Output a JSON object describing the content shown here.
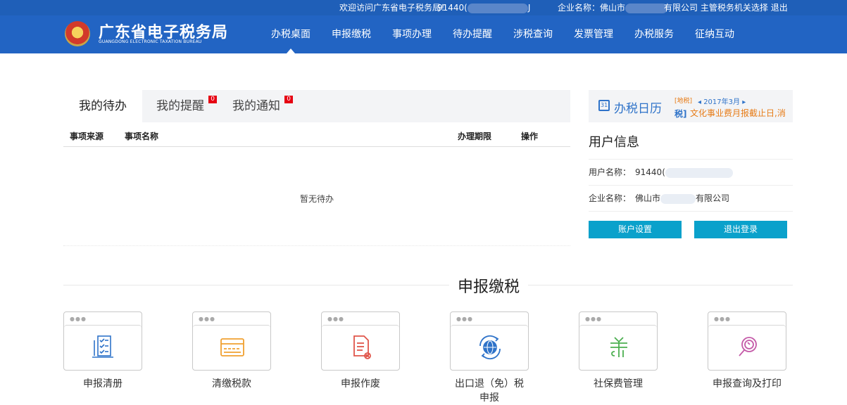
{
  "topbar": {
    "welcome": "欢迎访问广东省电子税务局！",
    "user_id_prefix": "91440(",
    "id_suffix": "J",
    "company_label": "企业名称：",
    "company_prefix": "佛山市",
    "company_suffix": "有限公司",
    "switch_authority": "主管税务机关选择",
    "logout": "退出"
  },
  "header": {
    "title": "广东省电子税务局",
    "subtitle": "GUANGDONG ELECTRONIC TAXATION BUREAU",
    "nav": [
      "办税桌面",
      "申报缴税",
      "事项办理",
      "待办提醒",
      "涉税查询",
      "发票管理",
      "办税服务",
      "征纳互动"
    ]
  },
  "todo": {
    "tabs": [
      {
        "label": "我的待办",
        "badge": ""
      },
      {
        "label": "我的提醒",
        "badge": "0"
      },
      {
        "label": "我的通知",
        "badge": "0"
      }
    ],
    "columns": [
      "事项来源",
      "事项名称",
      "办理期限",
      "操作"
    ],
    "empty_text": "暂无待办"
  },
  "calendar": {
    "title": "办税日历",
    "tag_local": "[地税]",
    "month": "◂ 2017年3月 ▸",
    "tag_tax": "税]",
    "event": "文化事业费月报截止日,消"
  },
  "user_info": {
    "title": "用户信息",
    "user_label": "用户名称：",
    "user_value": "91440(",
    "company_label": "企业名称：",
    "company_prefix": "佛山市",
    "company_suffix": "有限公司",
    "account_button": "账户设置",
    "logout_button": "退出登录"
  },
  "section": {
    "title": "申报缴税",
    "cards": [
      {
        "label": "申报清册",
        "icon": "checklist-icon",
        "color": "#2f73c9"
      },
      {
        "label": "清缴税款",
        "icon": "card-icon",
        "color": "#f0a030"
      },
      {
        "label": "申报作废",
        "icon": "void-document-icon",
        "color": "#e0554a"
      },
      {
        "label": "出口退（免）税申报",
        "icon": "globe-icon",
        "color": "#2f73c9"
      },
      {
        "label": "社保费管理",
        "icon": "social-security-icon",
        "color": "#4caf50"
      },
      {
        "label": "申报查询及打印",
        "icon": "search-print-icon",
        "color": "#c45aa8"
      }
    ]
  }
}
